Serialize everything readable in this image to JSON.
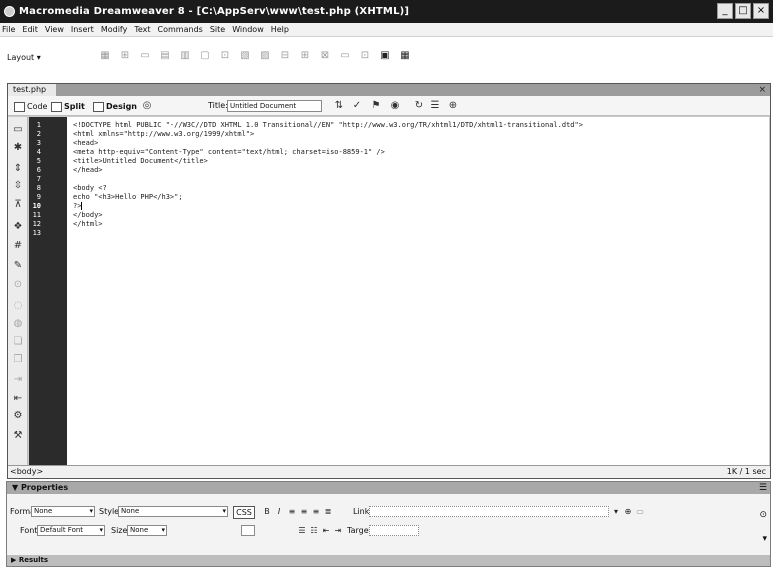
{
  "window": {
    "title": "Macromedia Dreamweaver 8 - [C:\\AppServ\\www\\test.php (XHTML)]",
    "controls": [
      "_",
      "□",
      "×"
    ]
  },
  "menu": [
    "File",
    "Edit",
    "View",
    "Insert",
    "Modify",
    "Text",
    "Commands",
    "Site",
    "Window",
    "Help"
  ],
  "insert_bar": {
    "layout_label": "Layout ▾"
  },
  "document": {
    "tab_label": "test.php",
    "close": "×",
    "views": {
      "code": "Code",
      "split": "Split",
      "design": "Design"
    },
    "title_label": "Title:",
    "title_value": "Untitled Document"
  },
  "code": {
    "line_numbers": [
      "1",
      "2",
      "3",
      "4",
      "5",
      "6",
      "7",
      "8",
      "9",
      "10",
      "11",
      "12",
      "13"
    ],
    "lines": [
      "<!DOCTYPE html PUBLIC \"-//W3C//DTD XHTML 1.0 Transitional//EN\" \"http://www.w3.org/TR/xhtml1/DTD/xhtml1-transitional.dtd\">",
      "<html xmlns=\"http://www.w3.org/1999/xhtml\">",
      "<head>",
      "<meta http-equiv=\"Content-Type\" content=\"text/html; charset=iso-8859-1\" />",
      "<title>Untitled Document</title>",
      "</head>",
      "",
      "<body <?",
      "echo \"<h3>Hello PHP</h3>\";",
      "?>",
      "</body>",
      "</html>",
      ""
    ]
  },
  "status": {
    "tag_selector": "<body>",
    "info": "1K / 1 sec"
  },
  "properties": {
    "header": "▼ Properties",
    "format_label": "Format",
    "format_value": "None",
    "style_label": "Style",
    "style_value": "None",
    "css_button": "CSS",
    "font_label": "Font",
    "font_value": "Default Font",
    "size_label": "Size",
    "size_value": "None",
    "link_label": "Link",
    "target_label": "Target",
    "results_bar": "▶ Results"
  }
}
